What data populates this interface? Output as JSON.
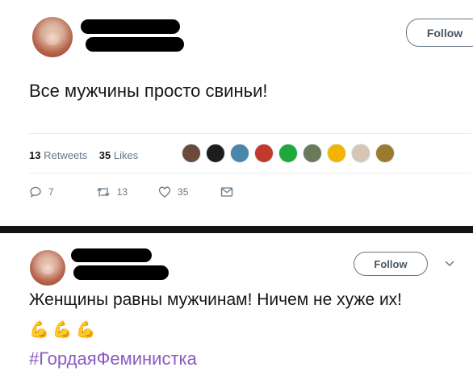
{
  "tweet1": {
    "follow_label": "Follow",
    "text": "Все мужчины просто свиньи!",
    "retweets_count": "13",
    "retweets_label": "Retweets",
    "likes_count": "35",
    "likes_label": "Likes",
    "actions": {
      "reply_count": "7",
      "retweet_count": "13",
      "like_count": "35"
    },
    "liker_colors": [
      "#6b4a3a",
      "#1d1d1d",
      "#4a86a8",
      "#c0392b",
      "#1fa83c",
      "#6b7a5a",
      "#f2b400",
      "#d8c6b4",
      "#9a7b2e"
    ]
  },
  "tweet2": {
    "follow_label": "Follow",
    "text": "Женщины равны мужчинам! Ничем не хуже их!",
    "emojis": [
      "💪",
      "💪",
      "💪"
    ],
    "hashtag": "#ГордаяФеминистка"
  },
  "colors": {
    "follow_border": "#657786",
    "hashtag": "#8a5ac4",
    "muted": "#657786"
  }
}
